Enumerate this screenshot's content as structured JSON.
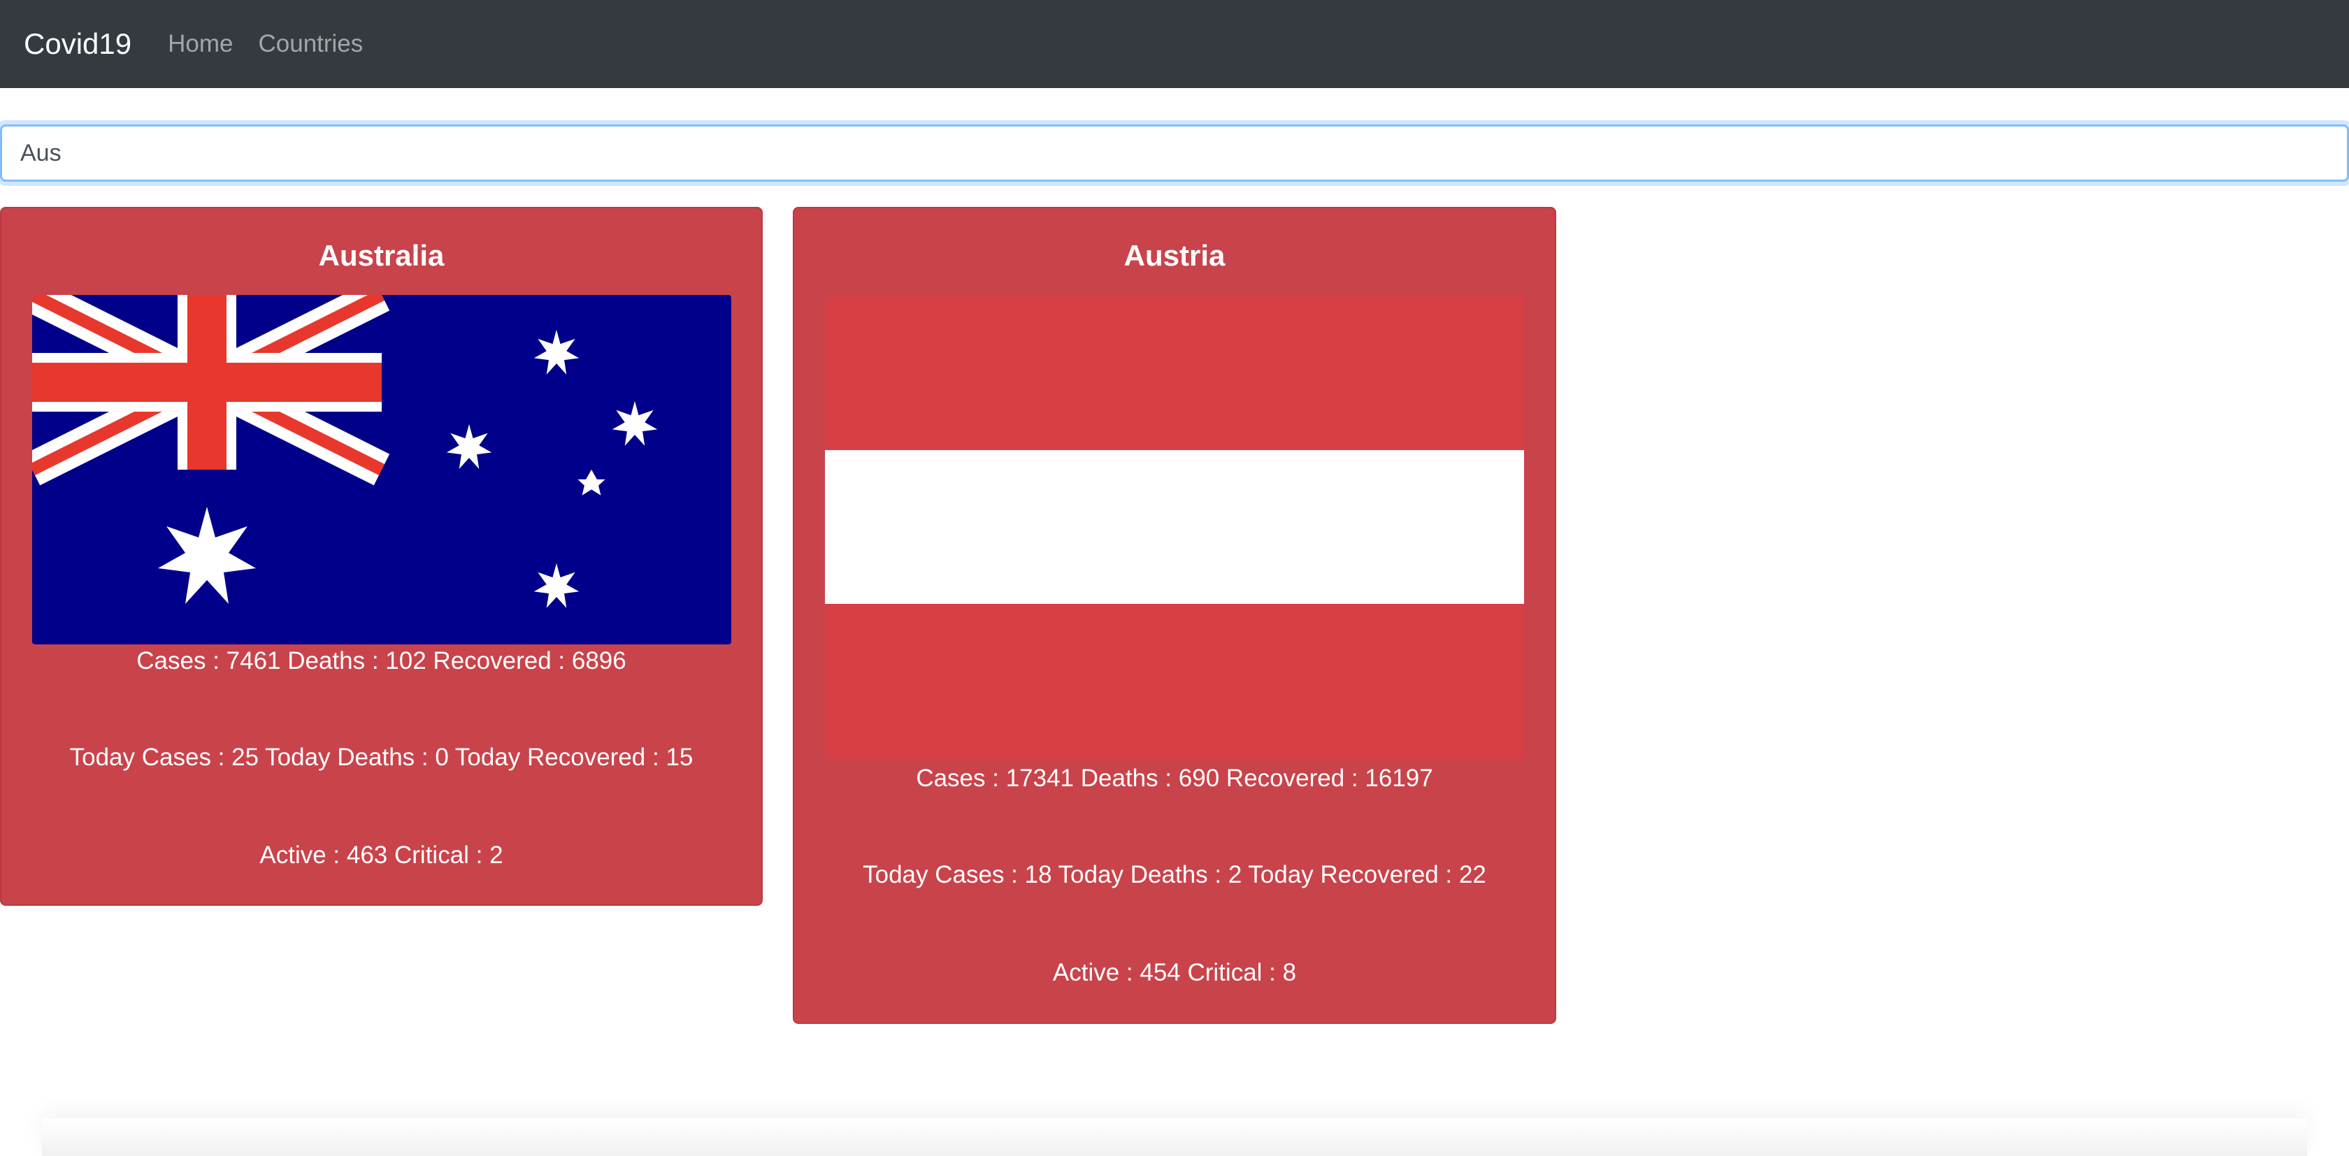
{
  "navbar": {
    "brand": "Covid19",
    "links": [
      "Home",
      "Countries"
    ],
    "background_color": "#343a40"
  },
  "search": {
    "value": "Aus",
    "placeholder": ""
  },
  "cards": [
    {
      "country": "Australia",
      "flag_icon": "australia-flag-icon",
      "line1": "Cases : 7461 Deaths : 102 Recovered : 6896",
      "line2": "Today Cases : 25 Today Deaths : 0 Today Recovered : 15",
      "line3": "Active : 463 Critical : 2"
    },
    {
      "country": "Austria",
      "flag_icon": "austria-flag-icon",
      "line1": "Cases : 17341 Deaths : 690 Recovered : 16197",
      "line2": "Today Cases : 18 Today Deaths : 2 Today Recovered : 22",
      "line3": "Active : 454 Critical : 8"
    }
  ],
  "colors": {
    "card_background": "#c9434b",
    "australia_blue": "#00008b",
    "austria_red": "#d64045"
  }
}
